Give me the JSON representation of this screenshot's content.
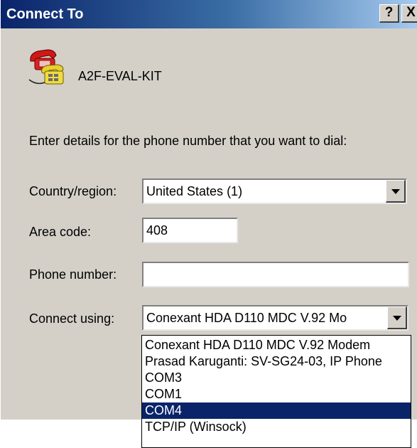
{
  "window": {
    "title": "Connect To",
    "help_button": "?",
    "close_button": "X"
  },
  "connection": {
    "icon": "phone-connection-icon",
    "name": "A2F-EVAL-KIT"
  },
  "prompt": "Enter details for the phone number that you want to dial:",
  "form": {
    "country": {
      "label": "Country/region:",
      "value": "United States (1)"
    },
    "area_code": {
      "label": "Area code:",
      "value": "408"
    },
    "phone_number": {
      "label": "Phone number:",
      "value": ""
    },
    "connect_using": {
      "label": "Connect using:",
      "value": "Conexant HDA D110 MDC V.92 Mo",
      "options": [
        "Conexant HDA D110 MDC V.92 Modem",
        "Prasad Karuganti: SV-SG24-03, IP Phone",
        "COM3",
        "COM1",
        "COM4",
        "TCP/IP (Winsock)"
      ],
      "selected_option": "COM4"
    }
  },
  "colors": {
    "titlebar_start": "#0a246a",
    "titlebar_end": "#a6caf0",
    "dialog_face": "#d4d0c8",
    "selection": "#0a246a"
  }
}
